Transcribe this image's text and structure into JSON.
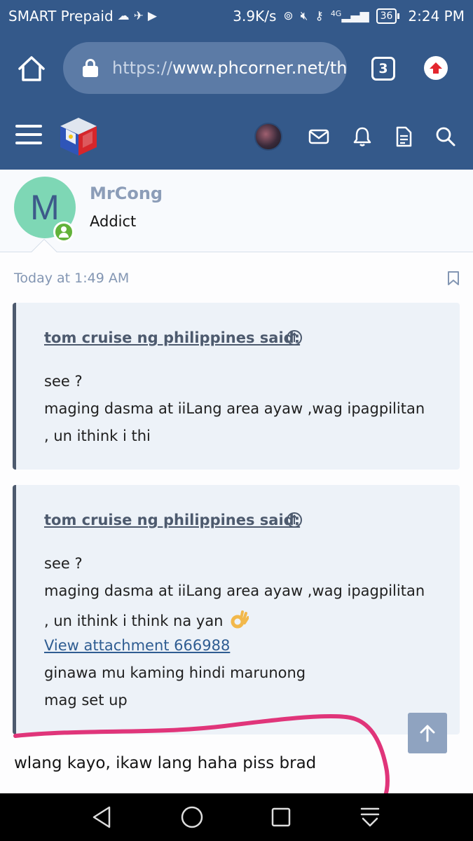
{
  "status_bar": {
    "carrier": "SMART Prepaid",
    "network_speed": "3.9K/s",
    "signal_label": "4G",
    "battery": "36",
    "time": "2:24 PM"
  },
  "browser": {
    "url_protocol": "https://",
    "url_host": "www.phcorner.net/th",
    "tab_count": "3"
  },
  "post": {
    "author": "MrCong",
    "author_initial": "M",
    "author_title": "Addict",
    "timestamp": "Today at 1:49 AM"
  },
  "quotes": [
    {
      "attribution": "tom cruise ng philippines said:",
      "lines": [
        "see ?",
        "maging dasma at iiLang area ayaw ,wag ipagpilitan",
        ", un ithink i thi"
      ]
    },
    {
      "attribution": "tom cruise ng philippines said:",
      "lines": [
        "see ?",
        "maging dasma at iiLang area ayaw ,wag ipagpilitan",
        ", un ithink i think na yan"
      ],
      "attachment_link": "View attachment 666988",
      "after_lines": [
        "ginawa mu kaming hindi marunong",
        "mag set up"
      ]
    }
  ],
  "reply_text": "wlang kayo, ikaw lang haha piss brad",
  "colors": {
    "header_bg": "#34598a",
    "url_bg": "#5c7ba6",
    "quote_bg": "#edf2f8",
    "quote_border": "#4d5a6e",
    "link": "#2f5d92",
    "scribble": "#e0357a"
  }
}
